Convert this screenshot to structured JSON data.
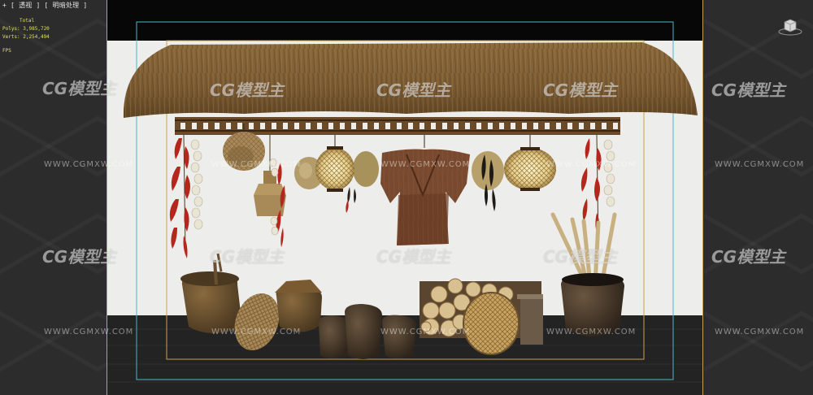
{
  "viewport": {
    "label": "+ [ 透视 ] [ 明暗处理 ]",
    "stats": {
      "total_label": "Total",
      "polys": "Polys: 3,985,720",
      "verts": "Verts: 2,254,494",
      "fps": "FPS"
    }
  },
  "watermark": {
    "logo_text": "CG模型主",
    "url": "WWW.CGMXW.COM"
  },
  "colors": {
    "viewport_bg": "#2c2c2c",
    "scene_bg": "#ededeb",
    "floor": "#222222",
    "safe_frame_gold": "#c8a24a",
    "safe_frame_cyan": "#4fb7c9",
    "stats_text": "#e0e060"
  },
  "icons": {
    "viewcube": "viewcube-icon"
  }
}
